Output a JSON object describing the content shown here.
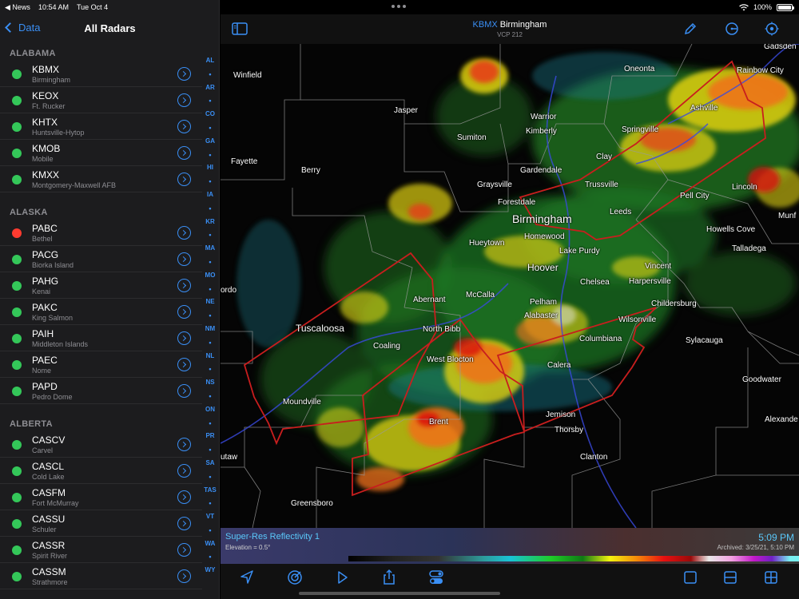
{
  "status_bar": {
    "back_app": "◀ News",
    "time": "10:54 AM",
    "date": "Tue Oct 4",
    "battery": "100%"
  },
  "sidebar": {
    "back_label": "Data",
    "title": "All Radars",
    "sections": [
      {
        "header": "ALABAMA",
        "items": [
          {
            "code": "KBMX",
            "name": "Birmingham",
            "status": "ok"
          },
          {
            "code": "KEOX",
            "name": "Ft. Rucker",
            "status": "ok"
          },
          {
            "code": "KHTX",
            "name": "Huntsville-Hytop",
            "status": "ok"
          },
          {
            "code": "KMOB",
            "name": "Mobile",
            "status": "ok"
          },
          {
            "code": "KMXX",
            "name": "Montgomery-Maxwell AFB",
            "status": "ok"
          }
        ]
      },
      {
        "header": "ALASKA",
        "items": [
          {
            "code": "PABC",
            "name": "Bethel",
            "status": "down"
          },
          {
            "code": "PACG",
            "name": "Biorka Island",
            "status": "ok"
          },
          {
            "code": "PAHG",
            "name": "Kenai",
            "status": "ok"
          },
          {
            "code": "PAKC",
            "name": "King Salmon",
            "status": "ok"
          },
          {
            "code": "PAIH",
            "name": "Middleton Islands",
            "status": "ok"
          },
          {
            "code": "PAEC",
            "name": "Nome",
            "status": "ok"
          },
          {
            "code": "PAPD",
            "name": "Pedro Dome",
            "status": "ok"
          }
        ]
      },
      {
        "header": "ALBERTA",
        "items": [
          {
            "code": "CASCV",
            "name": "Carvel",
            "status": "ok"
          },
          {
            "code": "CASCL",
            "name": "Cold Lake",
            "status": "ok"
          },
          {
            "code": "CASFM",
            "name": "Fort McMurray",
            "status": "ok"
          },
          {
            "code": "CASSU",
            "name": "Schuler",
            "status": "ok"
          },
          {
            "code": "CASSR",
            "name": "Spirit River",
            "status": "ok"
          },
          {
            "code": "CASSM",
            "name": "Strathmore",
            "status": "ok"
          }
        ]
      }
    ],
    "index": [
      "AL",
      "•",
      "AR",
      "•",
      "CO",
      "•",
      "GA",
      "•",
      "HI",
      "•",
      "IA",
      "•",
      "KR",
      "•",
      "MA",
      "•",
      "MO",
      "•",
      "NE",
      "•",
      "NM",
      "•",
      "NL",
      "•",
      "NS",
      "•",
      "ON",
      "•",
      "PR",
      "•",
      "SA",
      "•",
      "TAS",
      "•",
      "VT",
      "•",
      "WA",
      "•",
      "WY"
    ]
  },
  "radar": {
    "code": "KBMX",
    "name": "Birmingham",
    "vcp": "VCP 212",
    "product": "Super-Res Reflectivity 1",
    "elevation": "Elevation = 0.5°",
    "time": "5:09 PM",
    "archived": "Archived: 3/25/21, 5:10 PM"
  },
  "map_labels": {
    "winfield": "Winfield",
    "jasper": "Jasper",
    "warrior": "Warrior",
    "kimberly": "Kimberly",
    "oneonta": "Oneonta",
    "rainbow_city": "Rainbow City",
    "gadsden": "Gadsden",
    "ashville": "Ashville",
    "springville": "Springville",
    "sumiton": "Sumiton",
    "fayette": "Fayette",
    "berry": "Berry",
    "clay": "Clay",
    "gardendale": "Gardendale",
    "graysville": "Graysville",
    "trussville": "Trussville",
    "pell_city": "Pell City",
    "lincoln": "Lincoln",
    "forestdale": "Forestdale",
    "birmingham": "Birmingham",
    "leeds": "Leeds",
    "munford": "Munf",
    "hueytown": "Hueytown",
    "homewood": "Homewood",
    "howells_cove": "Howells Cove",
    "talladega": "Talladega",
    "lake_purdy": "Lake Purdy",
    "hoover": "Hoover",
    "vincent": "Vincent",
    "chelsea": "Chelsea",
    "harpersville": "Harpersville",
    "gordo": "ordo",
    "abernant": "Abernant",
    "mccalla": "McCalla",
    "pelham": "Pelham",
    "childersburg": "Childersburg",
    "tuscaloosa": "Tuscaloosa",
    "north_bibb": "North Bibb",
    "alabaster": "Alabaster",
    "wilsonville": "Wilsonville",
    "coaling": "Coaling",
    "columbiana": "Columbiana",
    "sylacauga": "Sylacauga",
    "west_blocton": "West Blocton",
    "calera": "Calera",
    "goodwater": "Goodwater",
    "moundville": "Moundville",
    "jemison": "Jemison",
    "alexander": "Alexande",
    "brent": "Brent",
    "thorsby": "Thorsby",
    "eutaw": "utaw",
    "clanton": "Clanton",
    "greensboro": "Greensboro"
  }
}
